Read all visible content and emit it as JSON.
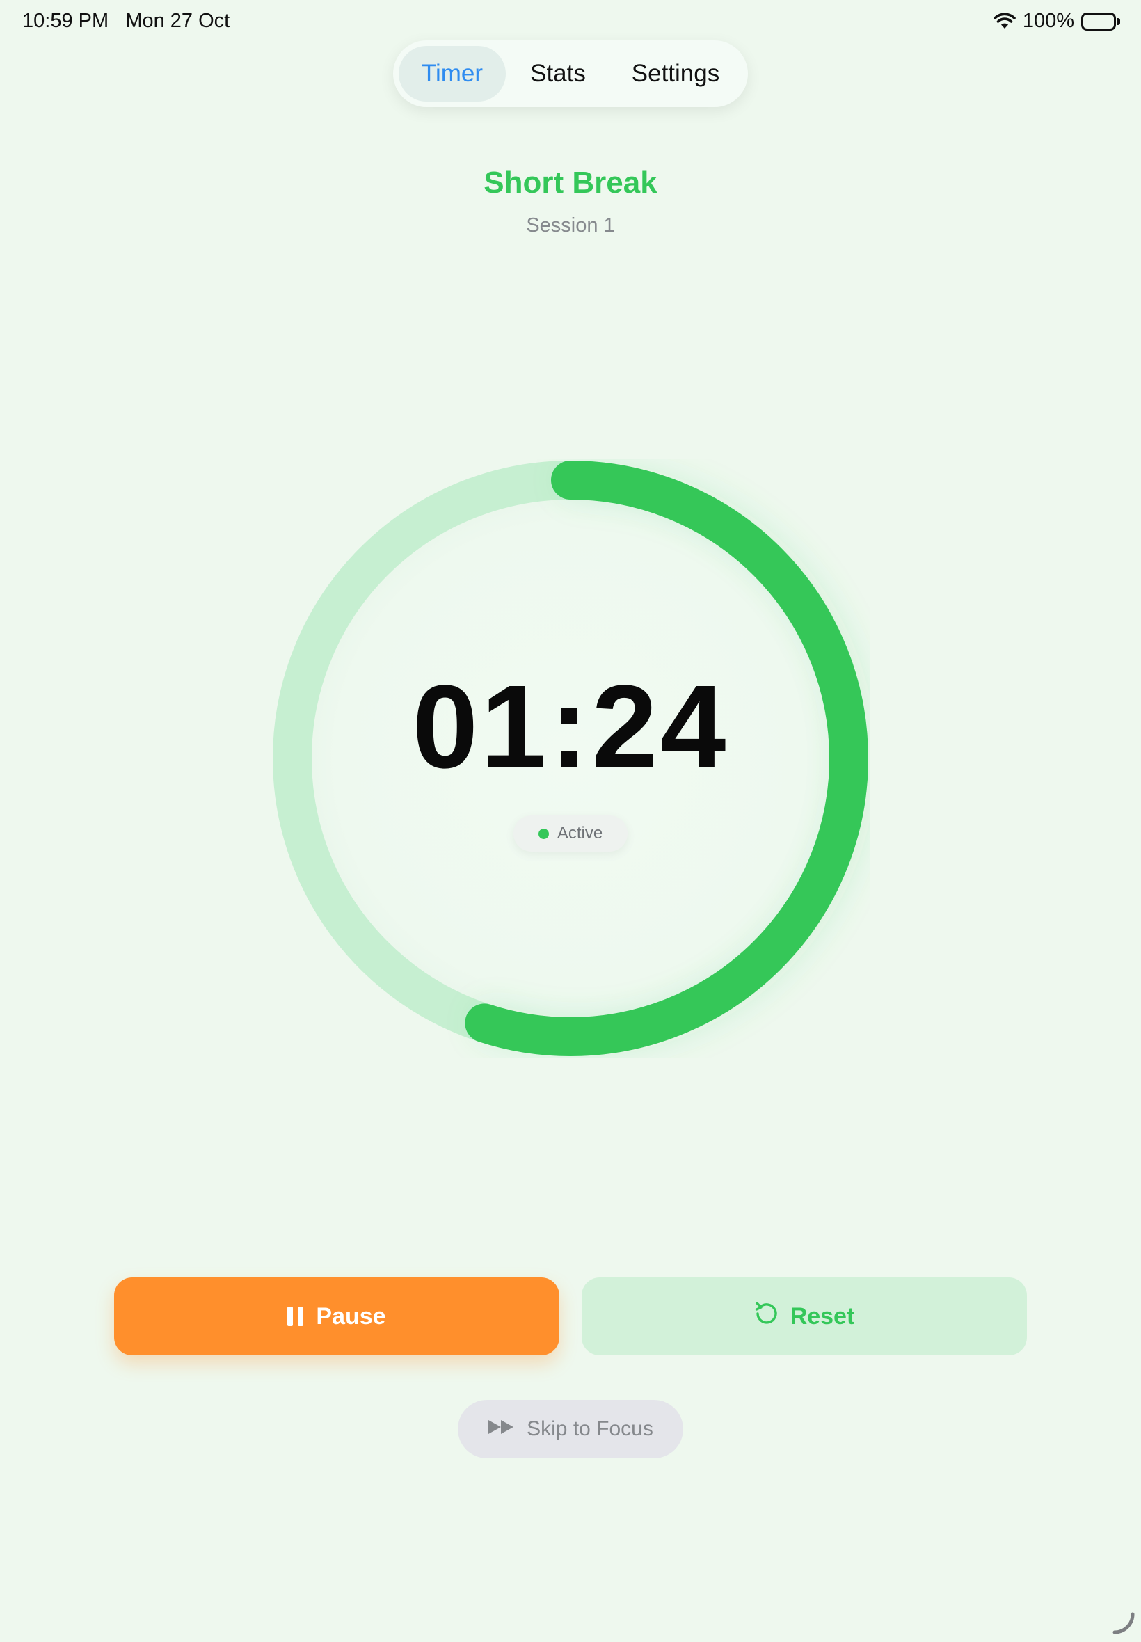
{
  "status_bar": {
    "time": "10:59 PM",
    "date": "Mon 27 Oct",
    "battery": "100%"
  },
  "tabs": [
    {
      "label": "Timer",
      "active": true
    },
    {
      "label": "Stats",
      "active": false
    },
    {
      "label": "Settings",
      "active": false
    }
  ],
  "timer": {
    "mode": "Short Break",
    "session": "Session 1",
    "remaining": "01:24",
    "status": "Active",
    "progress_fraction": 0.55
  },
  "actions": {
    "pause_label": "Pause",
    "reset_label": "Reset",
    "skip_label": "Skip to Focus"
  },
  "colors": {
    "accent_green": "#34c759",
    "pause_orange": "#ff8f2c",
    "tab_active_blue": "#2f8cf0",
    "background": "#eef8ee"
  },
  "icons": {
    "pause": "pause-icon",
    "reset": "reset-icon",
    "skip": "fast-forward-icon",
    "wifi": "wifi-icon",
    "battery": "battery-icon"
  }
}
